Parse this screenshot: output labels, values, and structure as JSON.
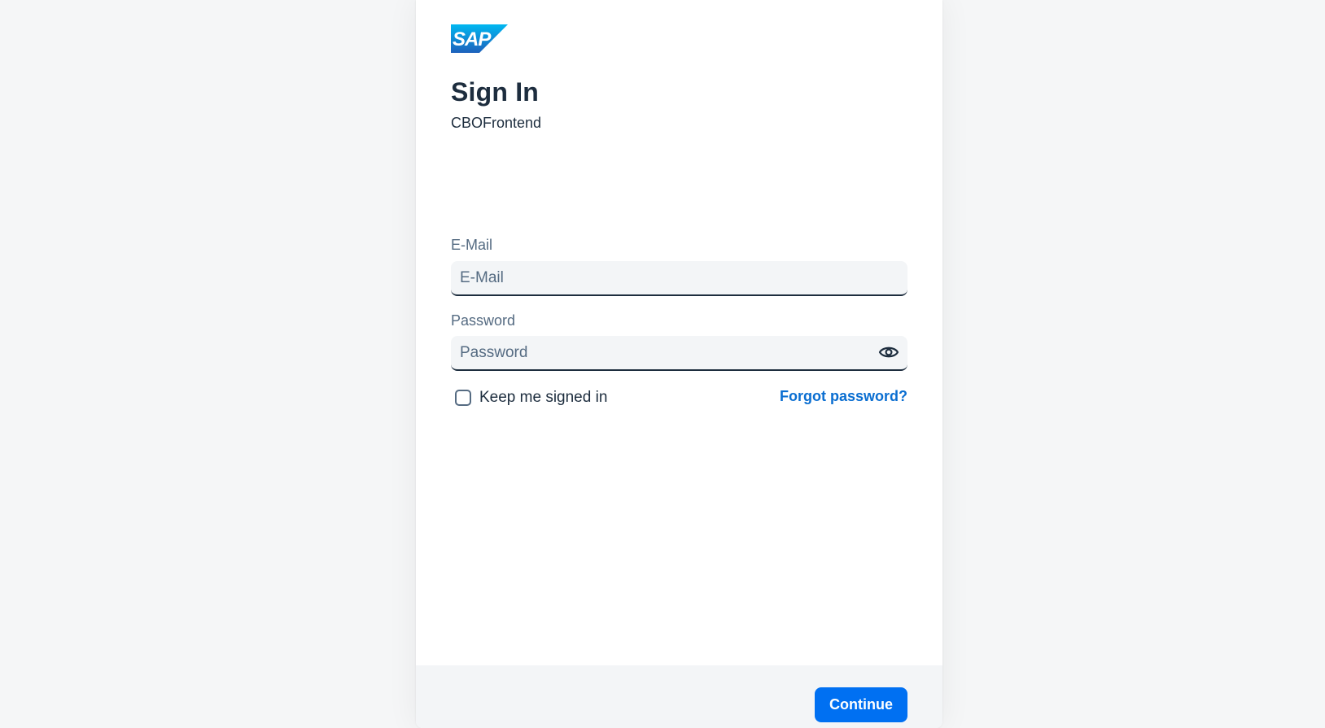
{
  "brand": {
    "logo_text": "SAP",
    "logo_gradient_top": "#00b8f1",
    "logo_gradient_bottom": "#1d61bc"
  },
  "header": {
    "title": "Sign In",
    "subtitle": "CBOFrontend"
  },
  "form": {
    "email": {
      "label": "E-Mail",
      "placeholder": "E-Mail",
      "value": ""
    },
    "password": {
      "label": "Password",
      "placeholder": "Password",
      "value": "",
      "toggle_icon": "eye-icon"
    },
    "keep_signed_in": {
      "label": "Keep me signed in",
      "checked": false
    },
    "forgot_password": "Forgot password?"
  },
  "footer": {
    "continue_label": "Continue"
  },
  "colors": {
    "accent": "#0070f2",
    "link": "#0a6ed1",
    "text": "#1d2d3e",
    "label": "#556b82",
    "background": "#f5f6f7",
    "field_bg": "#f3f5f7"
  }
}
